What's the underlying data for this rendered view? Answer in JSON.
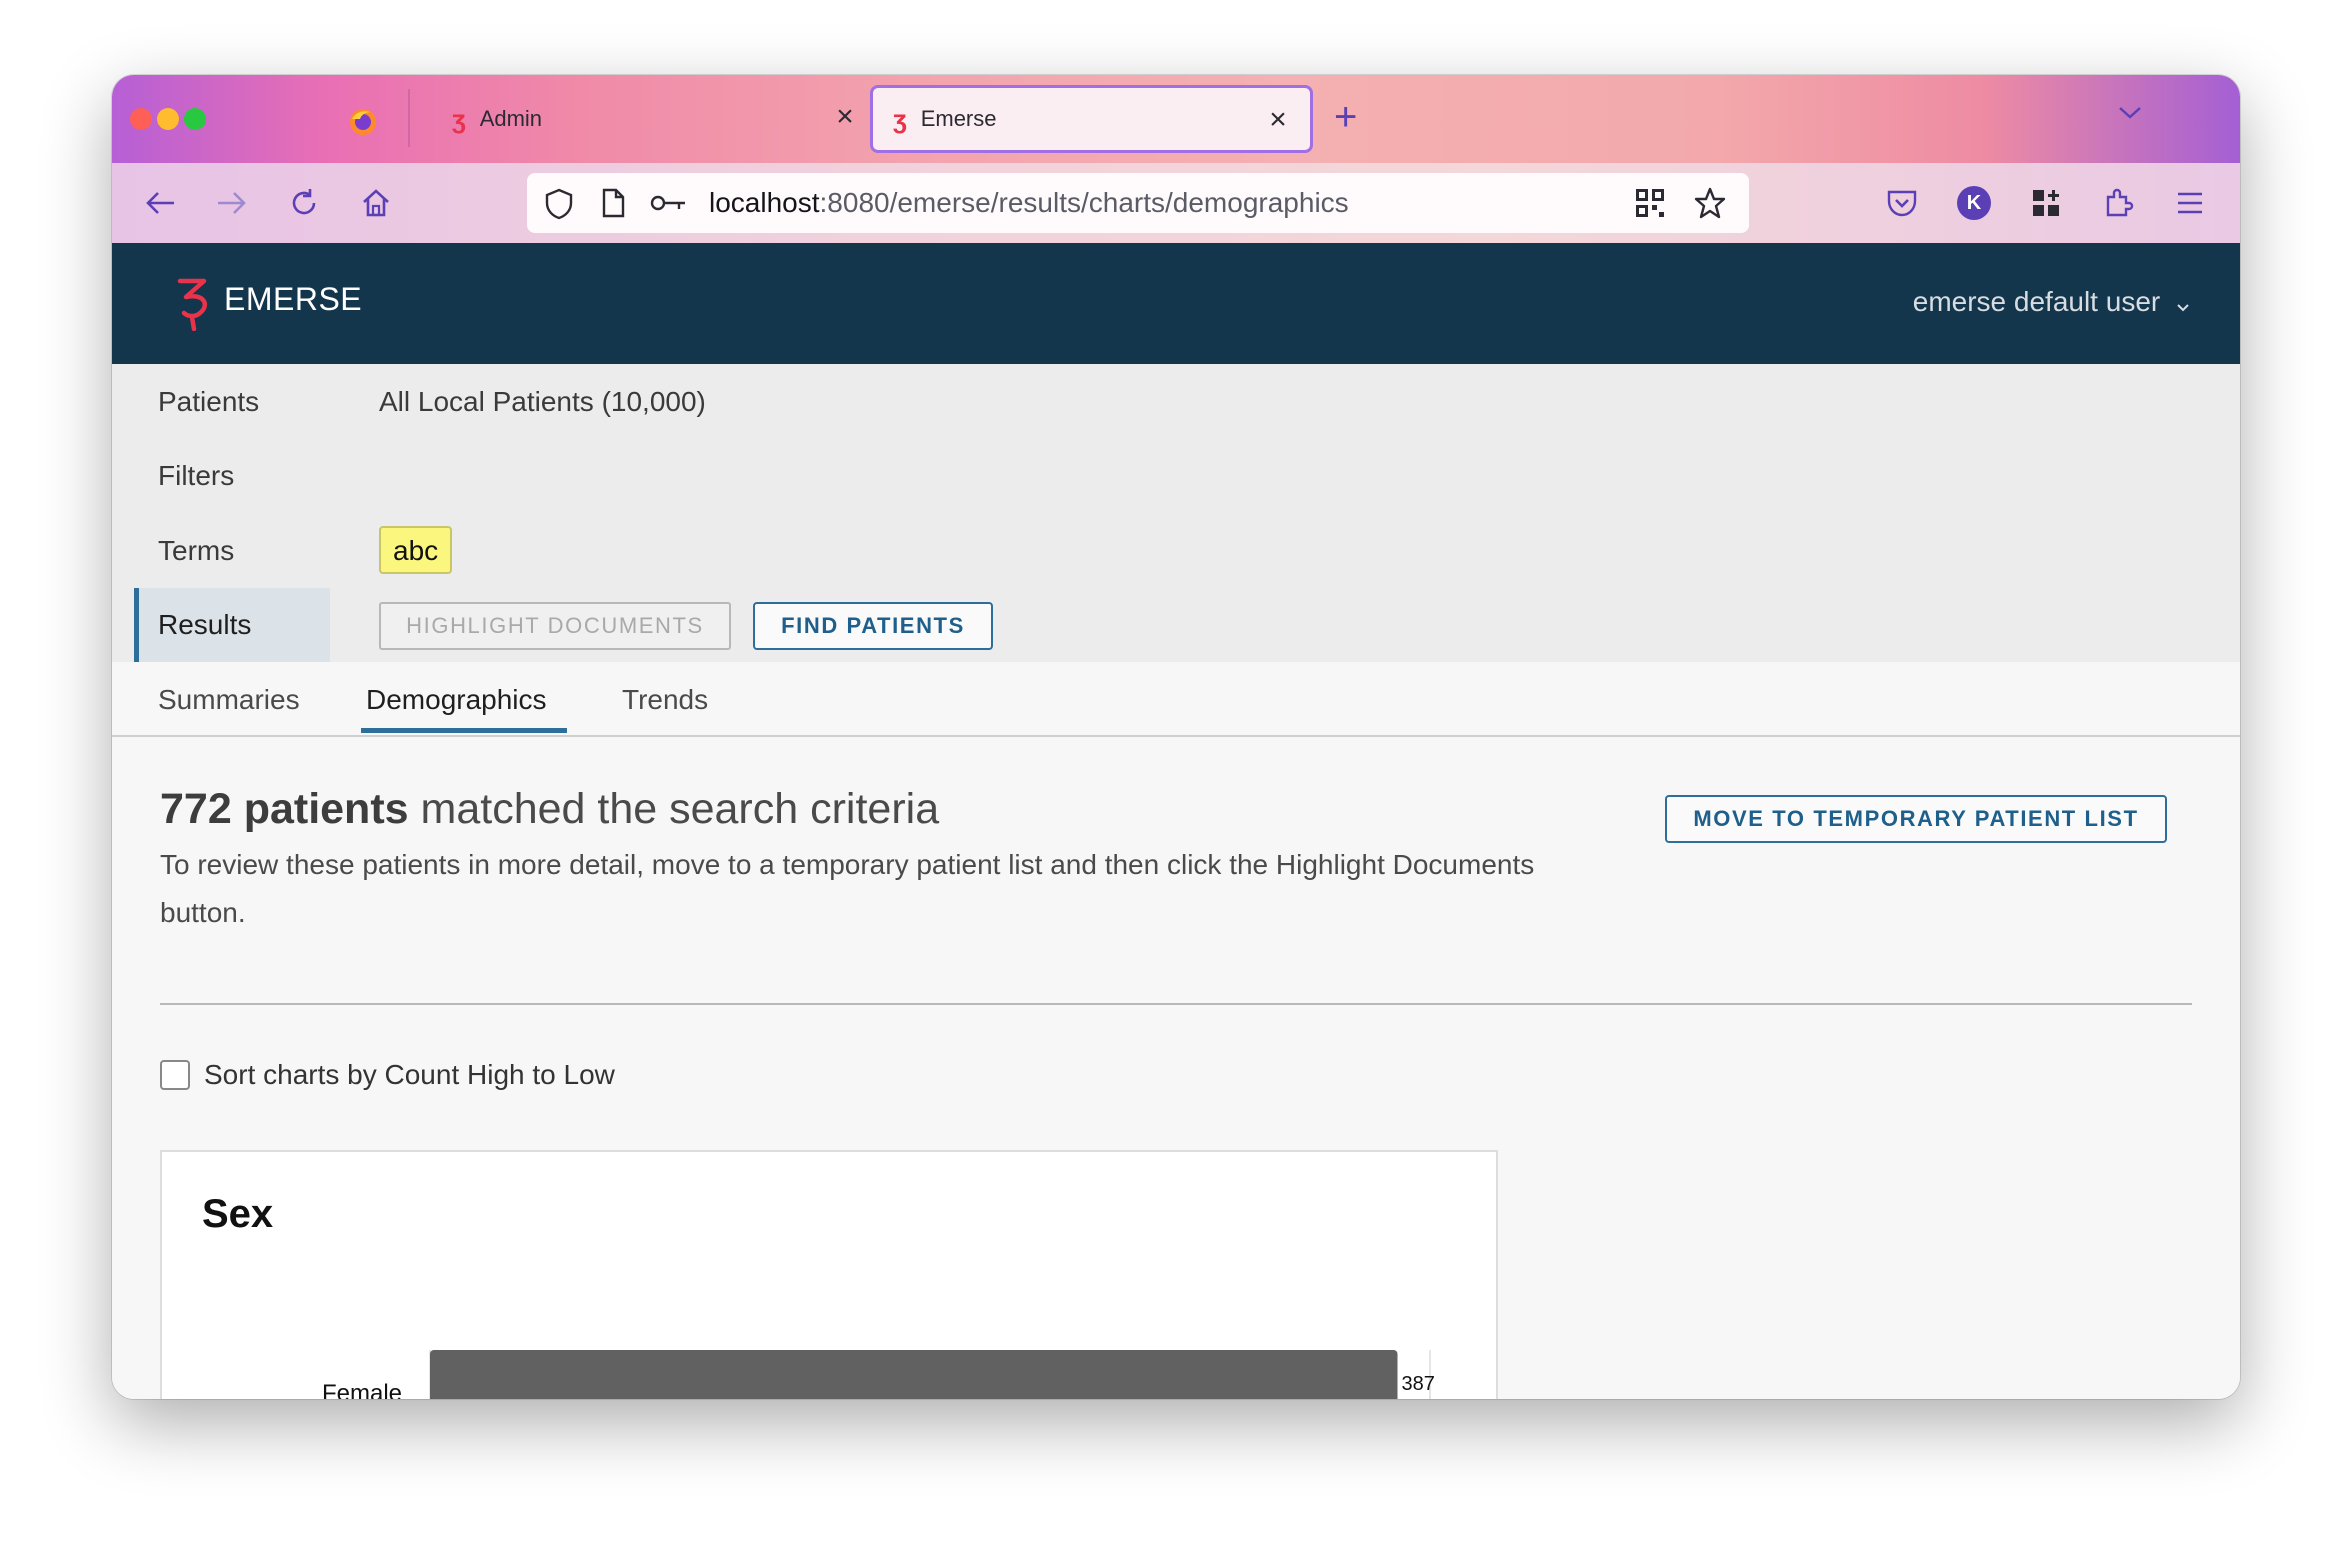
{
  "browser": {
    "tabs": [
      {
        "title": "Admin"
      },
      {
        "title": "Emerse"
      }
    ],
    "url_host": "localhost",
    "url_rest": ":8080/emerse/results/charts/demographics",
    "profile_initial": "K"
  },
  "app": {
    "brand": "EMERSE",
    "user_menu": "emerse default user"
  },
  "workflow": {
    "patients_label": "Patients",
    "patients_value": "All Local Patients (10,000)",
    "filters_label": "Filters",
    "terms_label": "Terms",
    "term_chip": "abc",
    "results_label": "Results",
    "highlight_button": "HIGHLIGHT DOCUMENTS",
    "find_button": "FIND PATIENTS"
  },
  "subtabs": {
    "summaries": "Summaries",
    "demographics": "Demographics",
    "trends": "Trends"
  },
  "content": {
    "count_text": "772 patients",
    "headline_rest": " matched the search criteria",
    "description": "To review these patients in more detail, move to a temporary patient list and then click the Highlight Documents button.",
    "move_button": "MOVE TO TEMPORARY PATIENT LIST",
    "sort_label": "Sort charts by Count High to Low",
    "sort_checked": false
  },
  "chart_data": {
    "type": "bar",
    "orientation": "horizontal",
    "title": "Sex",
    "categories": [
      "Female"
    ],
    "values": [
      387
    ],
    "data_labels": [
      "387"
    ],
    "xlim": [
      0,
      400
    ],
    "grid": true,
    "bar_color": "#616161"
  }
}
